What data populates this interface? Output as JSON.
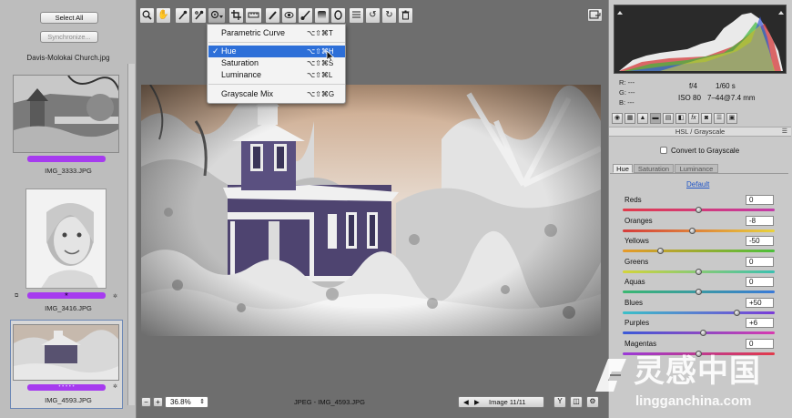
{
  "filmstrip": {
    "select_all": "Select All",
    "synchronize": "Synchronize...",
    "current_file": "Davis-Molokai Church.jpg",
    "items": [
      {
        "name": "IMG_3333.JPG",
        "stars": ""
      },
      {
        "name": "IMG_3416.JPG",
        "stars": "★"
      },
      {
        "name": "IMG_4593.JPG",
        "stars": "• • • • •"
      }
    ]
  },
  "menu": {
    "items": [
      {
        "label": "Parametric Curve",
        "shortcut": "⌥⇧⌘T",
        "selected": false
      },
      {
        "label": "Hue",
        "shortcut": "⌥⇧⌘H",
        "selected": true
      },
      {
        "label": "Saturation",
        "shortcut": "⌥⇧⌘S",
        "selected": false
      },
      {
        "label": "Luminance",
        "shortcut": "⌥⇧⌘L",
        "selected": false
      },
      {
        "label": "Grayscale Mix",
        "shortcut": "⌥⇧⌘G",
        "selected": false
      }
    ],
    "check": "✓"
  },
  "bottombar": {
    "zoom": "36.8%",
    "file_info": "JPEG - IMG_4593.JPG",
    "image_counter": "Image 11/11"
  },
  "camera": {
    "r_label": "R:",
    "g_label": "G:",
    "b_label": "B:",
    "rgb_value": "---",
    "aperture": "f/4",
    "shutter": "1/60 s",
    "iso": "ISO 80",
    "lens": "7–44@7.4 mm"
  },
  "panel": {
    "title": "HSL / Grayscale",
    "convert_label": "Convert to Grayscale",
    "tabs": [
      "Hue",
      "Saturation",
      "Luminance"
    ],
    "default_link": "Default",
    "sliders": [
      {
        "label": "Reds",
        "value": "0",
        "level": 0.5,
        "colors": [
          "#e23a4a",
          "#c23aa8"
        ]
      },
      {
        "label": "Oranges",
        "value": "-8",
        "level": 0.46,
        "colors": [
          "#d63b3b",
          "#e8d23b"
        ]
      },
      {
        "label": "Yellows",
        "value": "-50",
        "level": 0.25,
        "colors": [
          "#e89a2a",
          "#4bbf3a"
        ]
      },
      {
        "label": "Greens",
        "value": "0",
        "level": 0.5,
        "colors": [
          "#d4d43a",
          "#3ac0b0"
        ]
      },
      {
        "label": "Aquas",
        "value": "0",
        "level": 0.5,
        "colors": [
          "#3ab870",
          "#3a7ad8"
        ]
      },
      {
        "label": "Blues",
        "value": "+50",
        "level": 0.75,
        "colors": [
          "#3ac0c8",
          "#7a3ad8"
        ]
      },
      {
        "label": "Purples",
        "value": "+6",
        "level": 0.53,
        "colors": [
          "#3a5ad8",
          "#d83ab0"
        ]
      },
      {
        "label": "Magentas",
        "value": "0",
        "level": 0.5,
        "colors": [
          "#9a3ad8",
          "#e23a4a"
        ]
      }
    ]
  },
  "watermark": {
    "chinese": "灵感中国",
    "site": "lingganchina.com"
  },
  "colors": {
    "label_purple": "#a63bef",
    "menu_highlight": "#2d6fd8",
    "link_blue": "#1f55c8"
  },
  "icons": [
    "zoom-icon",
    "hand-icon",
    "eyedropper-icon",
    "color-sampler-icon",
    "targeted-adjust-icon",
    "crop-icon",
    "straighten-icon",
    "spot-removal-icon",
    "red-eye-icon",
    "adjustment-brush-icon",
    "graduated-filter-icon",
    "radial-filter-icon",
    "preferences-icon",
    "rotate-left-icon",
    "rotate-right-icon",
    "trash-icon",
    "fullscreen-icon"
  ]
}
